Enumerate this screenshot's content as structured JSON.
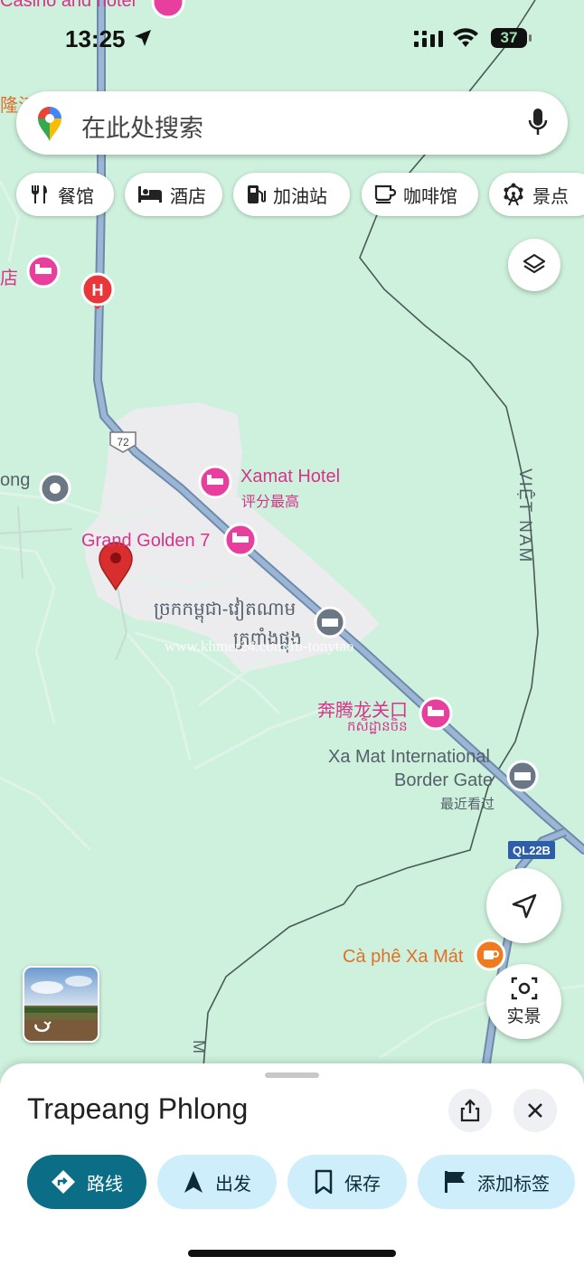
{
  "status_bar": {
    "time": "13:25",
    "battery_level": "37"
  },
  "search": {
    "placeholder": "在此处搜索"
  },
  "categories": [
    {
      "label": "餐馆",
      "icon": "fork-knife-icon"
    },
    {
      "label": "酒店",
      "icon": "bed-icon"
    },
    {
      "label": "加油站",
      "icon": "fuel-pump-icon"
    },
    {
      "label": "咖啡馆",
      "icon": "coffee-cup-icon"
    },
    {
      "label": "景点",
      "icon": "ferris-wheel-icon"
    }
  ],
  "map": {
    "road_shield_72": "72",
    "road_shield_ql22b": "QL22B",
    "country_label": "VIỆT NAM",
    "top_cut_label": "Casino and hotel",
    "left_cut_label_1": "隆江",
    "left_cut_label_2": "店",
    "left_cut_label_3": "ong",
    "xamat_hotel": "Xamat Hotel",
    "xamat_hotel_sub": "评分最高",
    "grand_golden": "Grand Golden 7",
    "khmer_border_line1": "ច្រកកម្ពុជា-វៀតណាម",
    "khmer_border_line2": "ត្រពាំងផ្លុង",
    "watermark": "www.khmer24.com/fb-tonytao",
    "benteng": "奔腾龙关口",
    "benteng_sub": "កសិដ្ឋានចិន",
    "xamat_gate_line1": "Xa Mat International",
    "xamat_gate_line2": "Border Gate",
    "xamat_gate_sub": "最近看过",
    "cafe": "Cà phê Xa Mát",
    "hospital_badge": "H"
  },
  "live_view_label": "实景",
  "place": {
    "title": "Trapeang Phlong",
    "actions": [
      {
        "label": "路线",
        "icon": "directions-icon"
      },
      {
        "label": "出发",
        "icon": "navigation-arrow-icon"
      },
      {
        "label": "保存",
        "icon": "bookmark-icon"
      },
      {
        "label": "添加标签",
        "icon": "flag-icon"
      }
    ]
  },
  "colors": {
    "map_background": "#cdf1dc",
    "road": "#8aa5c4",
    "hotel_pink": "#e83e9e",
    "primary_button": "#0b6e86",
    "secondary_button": "#cdeefa",
    "pin_red": "#d92e2e",
    "cafe_orange": "#f07a1e"
  }
}
